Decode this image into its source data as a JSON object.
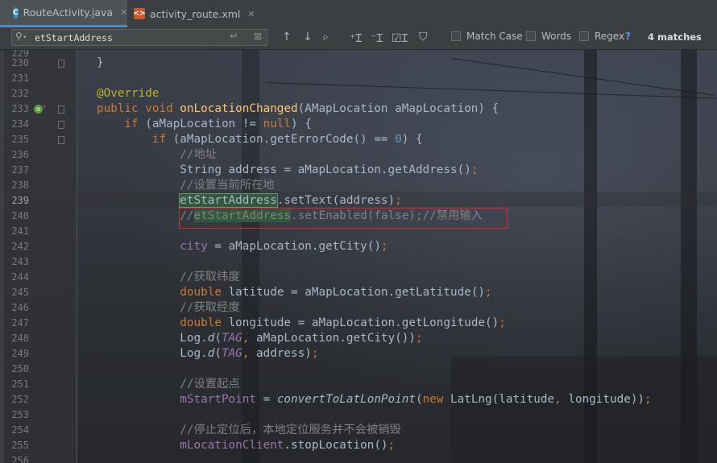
{
  "tabs": [
    {
      "label": "RouteActivity.java",
      "icon": "c-class-icon",
      "active": true
    },
    {
      "label": "activity_route.xml",
      "icon": "xml-file-icon",
      "active": false
    }
  ],
  "search": {
    "query": "etStartAddress",
    "match_case_label": "Match Case",
    "words_label": "Words",
    "regex_label": "Regex",
    "help": "?",
    "matches": "4 matches"
  },
  "editor": {
    "lines": [
      {
        "n": "229",
        "code": ""
      },
      {
        "n": "230",
        "code": "}"
      },
      {
        "n": "231",
        "code": ""
      },
      {
        "n": "232",
        "code": "@Override"
      },
      {
        "n": "233",
        "code": "public void onLocationChanged(AMapLocation aMapLocation) {"
      },
      {
        "n": "234",
        "code": "    if (aMapLocation != null) {"
      },
      {
        "n": "235",
        "code": "        if (aMapLocation.getErrorCode() == 0) {"
      },
      {
        "n": "236",
        "code": "            //地址"
      },
      {
        "n": "237",
        "code": "            String address = aMapLocation.getAddress();"
      },
      {
        "n": "238",
        "code": "            //设置当前所在地"
      },
      {
        "n": "239",
        "code": "            etStartAddress.setText(address);"
      },
      {
        "n": "240",
        "code": "            //etStartAddress.setEnabled(false);//禁用输入"
      },
      {
        "n": "241",
        "code": ""
      },
      {
        "n": "242",
        "code": "            city = aMapLocation.getCity();"
      },
      {
        "n": "243",
        "code": ""
      },
      {
        "n": "244",
        "code": "            //获取纬度"
      },
      {
        "n": "245",
        "code": "            double latitude = aMapLocation.getLatitude();"
      },
      {
        "n": "246",
        "code": "            //获取经度"
      },
      {
        "n": "247",
        "code": "            double longitude = aMapLocation.getLongitude();"
      },
      {
        "n": "248",
        "code": "            Log.d(TAG, aMapLocation.getCity());"
      },
      {
        "n": "249",
        "code": "            Log.d(TAG, address);"
      },
      {
        "n": "250",
        "code": ""
      },
      {
        "n": "251",
        "code": "            //设置起点"
      },
      {
        "n": "252",
        "code": "            mStartPoint = convertToLatLonPoint(new LatLng(latitude, longitude));"
      },
      {
        "n": "253",
        "code": ""
      },
      {
        "n": "254",
        "code": "            //停止定位后，本地定位服务并不会被销毁"
      },
      {
        "n": "255",
        "code": "            mLocationClient.stopLocation();"
      },
      {
        "n": "256",
        "code": ""
      }
    ]
  },
  "colors": {
    "keyword": "#cc7832",
    "annotation": "#bbb529",
    "method": "#ffc66d",
    "number": "#6897bb",
    "comment": "#808080",
    "static_field": "#9876aa",
    "search_highlight": "#32593d",
    "red_box": "#d9262b"
  }
}
